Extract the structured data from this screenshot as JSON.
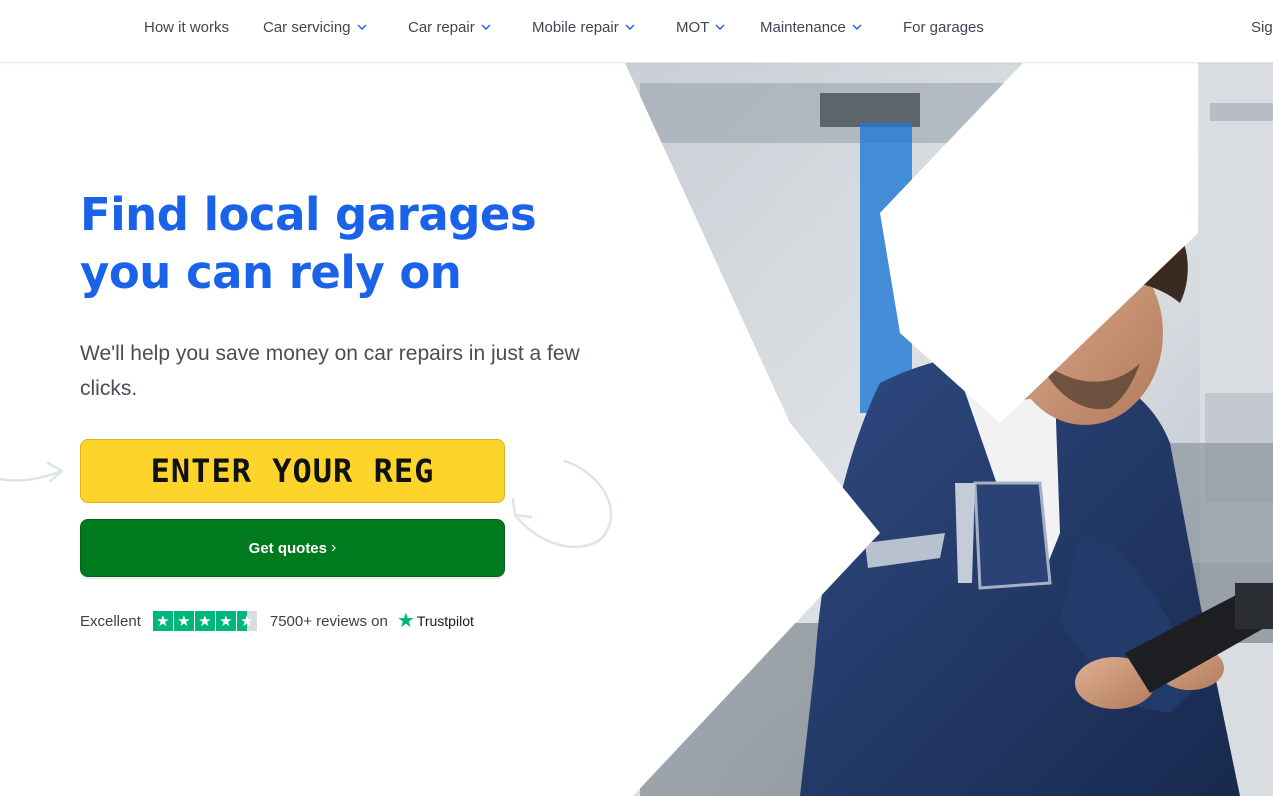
{
  "nav": {
    "items": [
      {
        "label": "How it works",
        "dropdown": false
      },
      {
        "label": "Car servicing",
        "dropdown": true
      },
      {
        "label": "Car repair",
        "dropdown": true
      },
      {
        "label": "Mobile repair",
        "dropdown": true
      },
      {
        "label": "MOT",
        "dropdown": true
      },
      {
        "label": "Maintenance",
        "dropdown": true
      },
      {
        "label": "For garages",
        "dropdown": false
      }
    ],
    "sign_in": "Sig"
  },
  "hero": {
    "headline": "Find local garages you can rely on",
    "subhead": "We'll help you save money on car repairs in just a few clicks.",
    "reg_placeholder": "ENTER YOUR REG",
    "cta_label": "Get quotes",
    "cta_arrow": "›"
  },
  "trust": {
    "rating_text": "Excellent",
    "stars": 4.5,
    "reviews_text": "7500+ reviews on",
    "brand": "Trustpilot"
  },
  "colors": {
    "headline": "#1a63e8",
    "reg_yellow": "#fdd52a",
    "cta_green": "#007a1e",
    "trustpilot_green": "#00b67a",
    "overall_navy": "#1f3563"
  },
  "icons": {
    "nav_dropdown": "chevron-down-icon",
    "cta": "chevron-right-icon",
    "trustpilot": "star-icon"
  }
}
